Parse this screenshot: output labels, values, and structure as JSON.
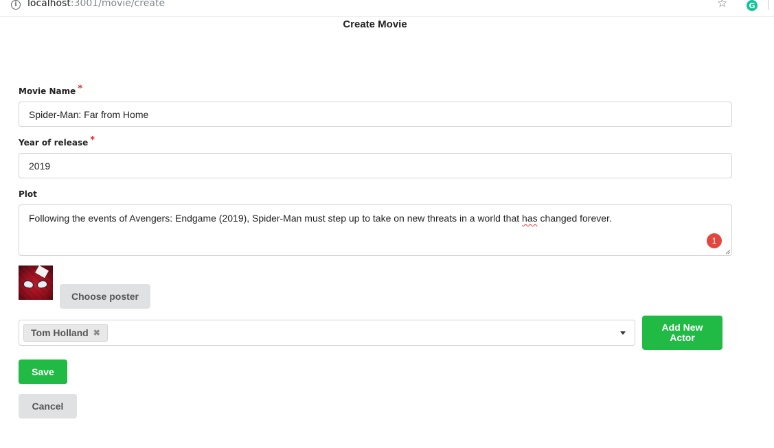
{
  "browser": {
    "url_host": "localhost",
    "url_path": ":3001/movie/create"
  },
  "page": {
    "title": "Create Movie"
  },
  "form": {
    "movie_name": {
      "label": "Movie Name",
      "required_mark": "*",
      "value": "Spider-Man: Far from Home"
    },
    "year": {
      "label": "Year of release",
      "required_mark": "*",
      "value": "2019"
    },
    "plot": {
      "label": "Plot",
      "value_before": "Following the events of Avengers: Endgame (2019), Spider-Man must step up to take on new threats in a world that ",
      "value_flagged": "has",
      "value_after": " changed forever.",
      "grammarly_count": "1"
    },
    "poster": {
      "choose_label": "Choose poster"
    },
    "actors": {
      "selected": [
        "Tom Holland"
      ],
      "remove_glyph": "✖",
      "add_new_label": "Add New\nActor"
    },
    "save_label": "Save",
    "cancel_label": "Cancel"
  },
  "colors": {
    "primary_green": "#21ba45",
    "secondary_grey": "#e0e1e2",
    "required_red": "#db2828",
    "grammarly_badge": "#e2463d"
  }
}
